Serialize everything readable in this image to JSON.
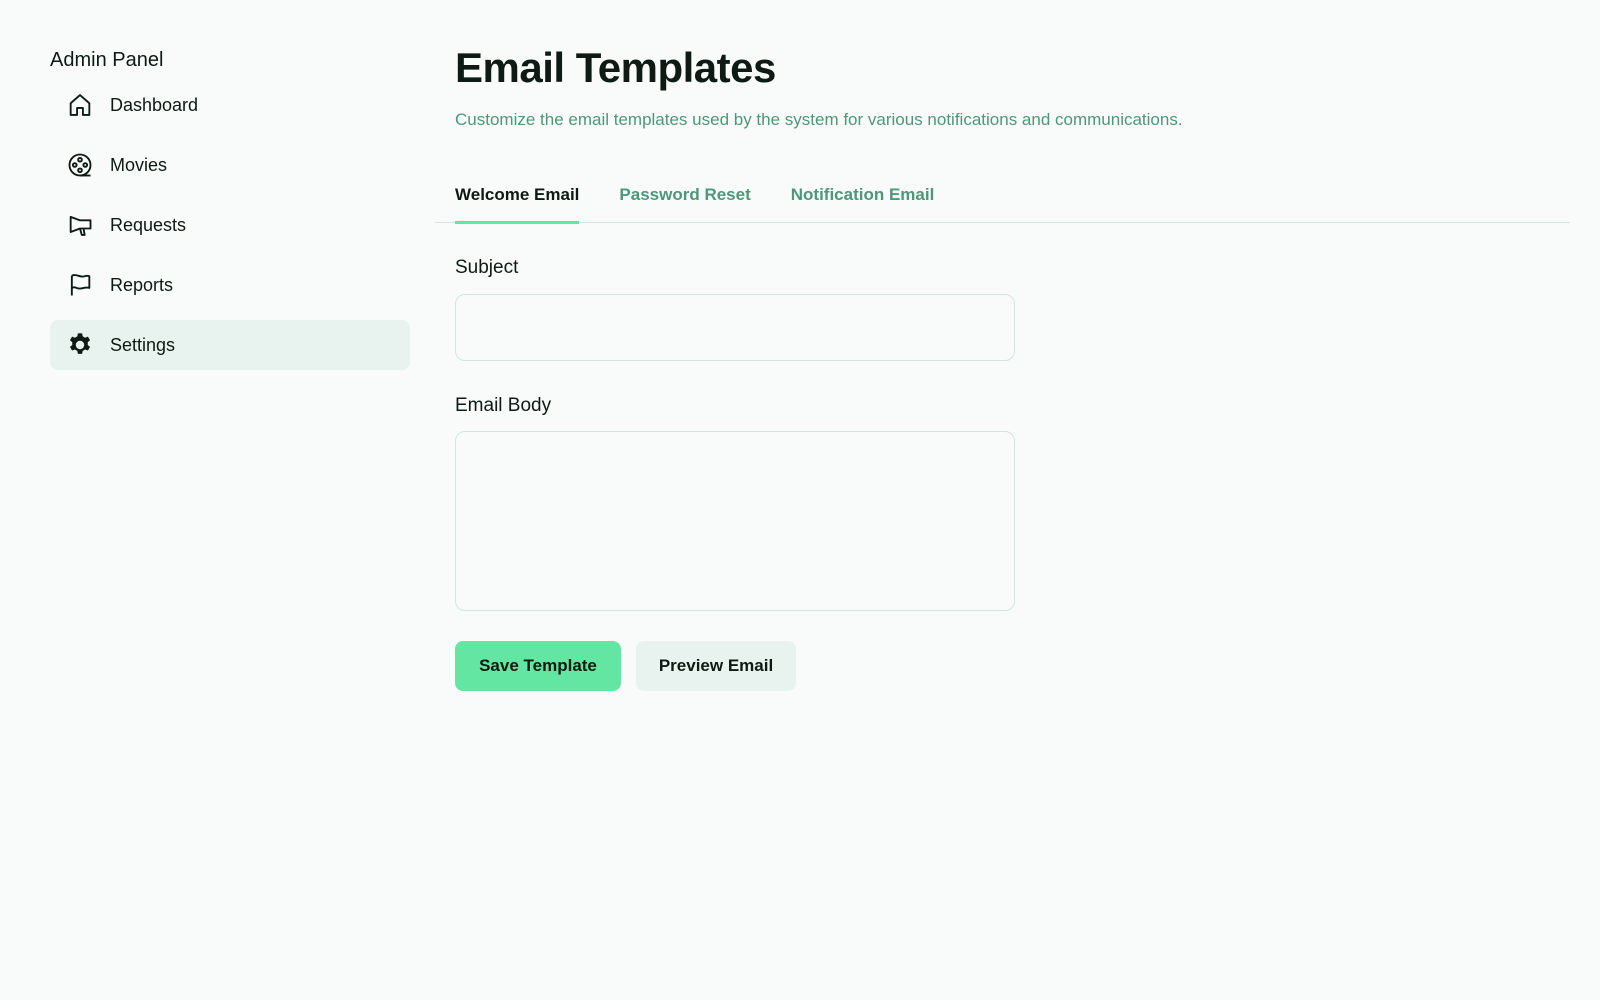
{
  "sidebar": {
    "title": "Admin Panel",
    "items": [
      {
        "label": "Dashboard",
        "icon": "house-icon",
        "active": false
      },
      {
        "label": "Movies",
        "icon": "film-reel-icon",
        "active": false
      },
      {
        "label": "Requests",
        "icon": "megaphone-icon",
        "active": false
      },
      {
        "label": "Reports",
        "icon": "flag-icon",
        "active": false
      },
      {
        "label": "Settings",
        "icon": "gear-icon",
        "active": true
      }
    ]
  },
  "main": {
    "title": "Email Templates",
    "subtitle": "Customize the email templates used by the system for various notifications and communications.",
    "tabs": [
      {
        "label": "Welcome Email",
        "active": true
      },
      {
        "label": "Password Reset",
        "active": false
      },
      {
        "label": "Notification Email",
        "active": false
      }
    ],
    "form": {
      "subject_label": "Subject",
      "subject_value": "",
      "body_label": "Email Body",
      "body_value": ""
    },
    "actions": {
      "save_label": "Save Template",
      "preview_label": "Preview Email"
    }
  },
  "colors": {
    "background": "#f8fbfa",
    "text": "#0e1a13",
    "muted": "#4e9778",
    "accent": "#62e6a1",
    "active_bg": "#e8f2ee",
    "border": "#d1e6dd"
  }
}
